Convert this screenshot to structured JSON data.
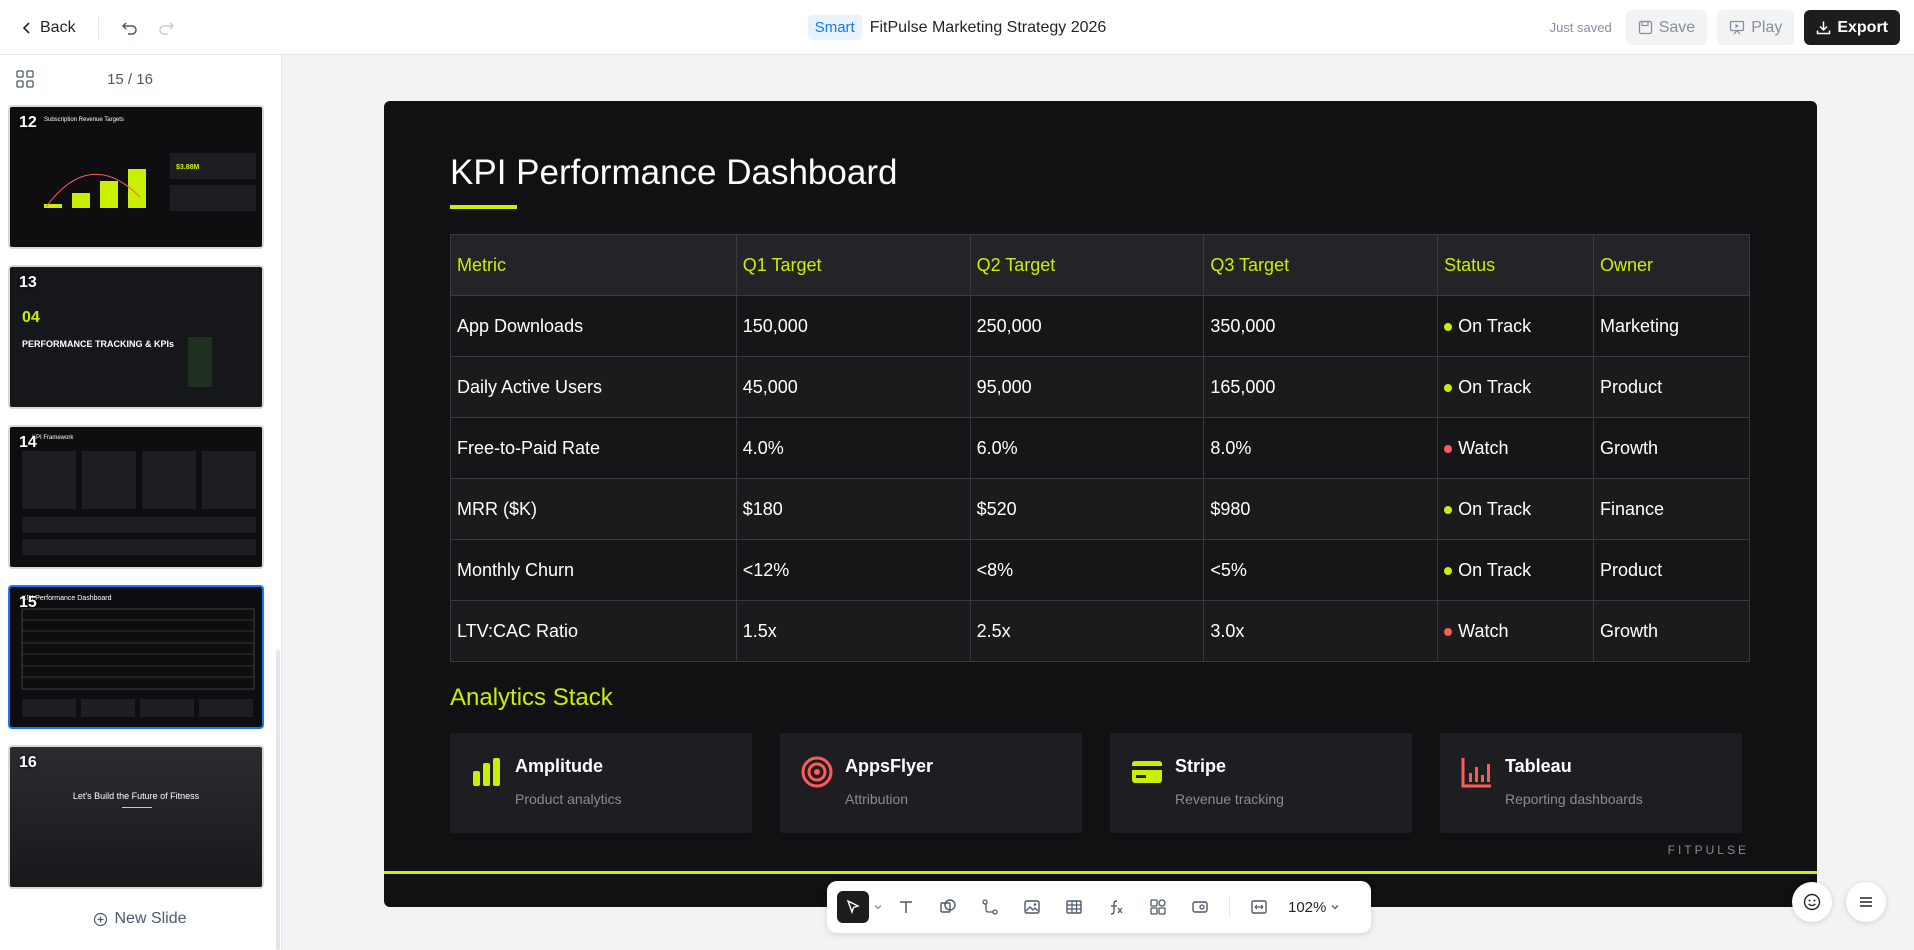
{
  "header": {
    "back_label": "Back",
    "smart_badge": "Smart",
    "doc_title": "FitPulse Marketing Strategy 2026",
    "saved_status": "Just saved",
    "save_label": "Save",
    "play_label": "Play",
    "export_label": "Export"
  },
  "sidebar": {
    "page_counter": "15 / 16",
    "new_slide_label": "New Slide",
    "thumbnails": [
      {
        "num": "12",
        "title": "Subscription Revenue Targets"
      },
      {
        "num": "13",
        "title": "PERFORMANCE TRACKING & KPIs",
        "big": "04"
      },
      {
        "num": "14",
        "title": "KPI Framework"
      },
      {
        "num": "15",
        "title": "KPI Performance Dashboard"
      },
      {
        "num": "16",
        "title": "Let's Build the Future of Fitness"
      }
    ]
  },
  "slide": {
    "title": "KPI Performance Dashboard",
    "columns": [
      "Metric",
      "Q1 Target",
      "Q2 Target",
      "Q3 Target",
      "Status",
      "Owner"
    ],
    "rows": [
      {
        "metric": "App Downloads",
        "q1": "150,000",
        "q2": "250,000",
        "q3": "350,000",
        "status": "On Track",
        "status_color": "green",
        "owner": "Marketing"
      },
      {
        "metric": "Daily Active Users",
        "q1": "45,000",
        "q2": "95,000",
        "q3": "165,000",
        "status": "On Track",
        "status_color": "green",
        "owner": "Product"
      },
      {
        "metric": "Free-to-Paid Rate",
        "q1": "4.0%",
        "q2": "6.0%",
        "q3": "8.0%",
        "status": "Watch",
        "status_color": "red",
        "owner": "Growth"
      },
      {
        "metric": "MRR ($K)",
        "q1": "$180",
        "q2": "$520",
        "q3": "$980",
        "status": "On Track",
        "status_color": "green",
        "owner": "Finance"
      },
      {
        "metric": "Monthly Churn",
        "q1": "<12%",
        "q2": "<8%",
        "q3": "<5%",
        "status": "On Track",
        "status_color": "green",
        "owner": "Product"
      },
      {
        "metric": "LTV:CAC Ratio",
        "q1": "1.5x",
        "q2": "2.5x",
        "q3": "3.0x",
        "status": "Watch",
        "status_color": "red",
        "owner": "Growth"
      }
    ],
    "analytics_title": "Analytics Stack",
    "tools": [
      {
        "name": "Amplitude",
        "desc": "Product analytics",
        "icon": "bar-chart-icon"
      },
      {
        "name": "AppsFlyer",
        "desc": "Attribution",
        "icon": "target-icon"
      },
      {
        "name": "Stripe",
        "desc": "Revenue tracking",
        "icon": "credit-card-icon"
      },
      {
        "name": "Tableau",
        "desc": "Reporting dashboards",
        "icon": "chart-icon"
      }
    ],
    "brand": "FITPULSE"
  },
  "toolbar": {
    "zoom": "102%"
  },
  "colors": {
    "accent": "#c8f000",
    "watch": "#ff5a5a",
    "slide_bg": "#111114"
  }
}
